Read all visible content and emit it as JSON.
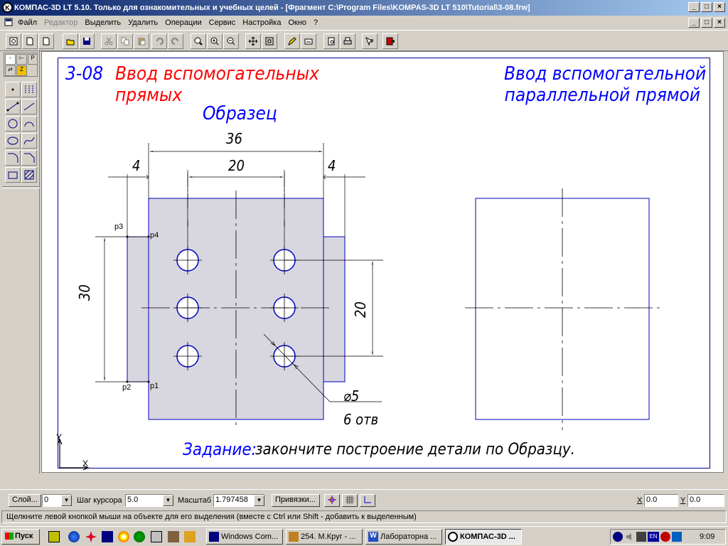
{
  "window": {
    "title": "КОМПАС-3D LT 5.10. Только для ознакомительных и учебных целей - [Фрагмент C:\\Program Files\\KOMPAS-3D LT 510\\Tutorial\\3-08.frw]",
    "minimize": "_",
    "restore": "□",
    "close": "×",
    "doc_minimize": "_",
    "doc_restore": "□",
    "doc_close": "×"
  },
  "menu": {
    "items": [
      "Файл",
      "Редактор",
      "Выделить",
      "Удалить",
      "Операции",
      "Сервис",
      "Настройка",
      "Окно",
      "?"
    ],
    "disabled": [
      false,
      true,
      false,
      false,
      false,
      false,
      false,
      false,
      false
    ]
  },
  "toolbar": {
    "icons": [
      "new-fragment-icon",
      "new-document-icon",
      "new-sheet-icon",
      "open-icon",
      "save-icon",
      "cut-icon",
      "copy-icon",
      "paste-icon",
      "undo-icon",
      "redo-icon",
      "zoom-window-icon",
      "zoom-in-icon",
      "zoom-out-icon",
      "pan-icon",
      "zoom-all-icon",
      "pencil-icon",
      "properties-icon",
      "print-preview-icon",
      "print-icon",
      "help-icon",
      "exit-icon"
    ]
  },
  "left_toolbar": {
    "tabs": [
      "geometry-tab-icon",
      "dimensions-tab-icon",
      "parameters-tab-icon",
      "edit-tab-icon",
      "measure-tab-icon"
    ],
    "tools": [
      "point-icon",
      "aux-line-icon",
      "segment-icon",
      "parallel-segment-icon",
      "circle-icon",
      "arc-icon",
      "ellipse-icon",
      "spline-icon",
      "fillet-icon",
      "chamfer-icon",
      "rectangle-icon",
      "hatch-icon"
    ]
  },
  "drawing": {
    "heading_number": "3-08",
    "heading_red": "Ввод вспомогательных",
    "heading_red2": "прямых",
    "sample": "Образец",
    "right_title_1": "Ввод вспомогательной",
    "right_title_2": "параллельной прямой",
    "dim_36": "36",
    "dim_20_top": "20",
    "dim_4_left": "4",
    "dim_4_right": "4",
    "dim_30": "30",
    "dim_20_right": "20",
    "dim_d5": "⌀5",
    "holes_note": "6 отв",
    "p1": "p1",
    "p2": "p2",
    "p3": "p3",
    "p4": "p4",
    "task_label": "Задание:",
    "task_text": "закончите построение детали по Образцу.",
    "axis_x": "X",
    "axis_y": "Y"
  },
  "statusbar": {
    "layer_btn": "Слой...",
    "layer_value": "0",
    "step_label": "Шаг курсора",
    "step_value": "5.0",
    "scale_label": "Масштаб",
    "scale_value": "1.797458",
    "snap_btn": "Привязки...",
    "x_label": "X",
    "x_value": "0.0",
    "y_label": "Y",
    "y_value": "0.0"
  },
  "message": "Щелкните левой кнопкой мыши на объекте для его выделения (вместе с Ctrl или Shift - добавить к выделенным)",
  "taskbar": {
    "start": "Пуск",
    "tasks": [
      "Windows Com...",
      "254. М.Круг - ...",
      "Лабораторна ...",
      "КОМПАС-3D ..."
    ],
    "tray_time": "9:09",
    "lang": "EN"
  },
  "colors": {
    "accent_red": "#ff0000",
    "accent_blue": "#0000ff",
    "part_fill": "#d8d6df",
    "title_bar": "#0a246a"
  }
}
